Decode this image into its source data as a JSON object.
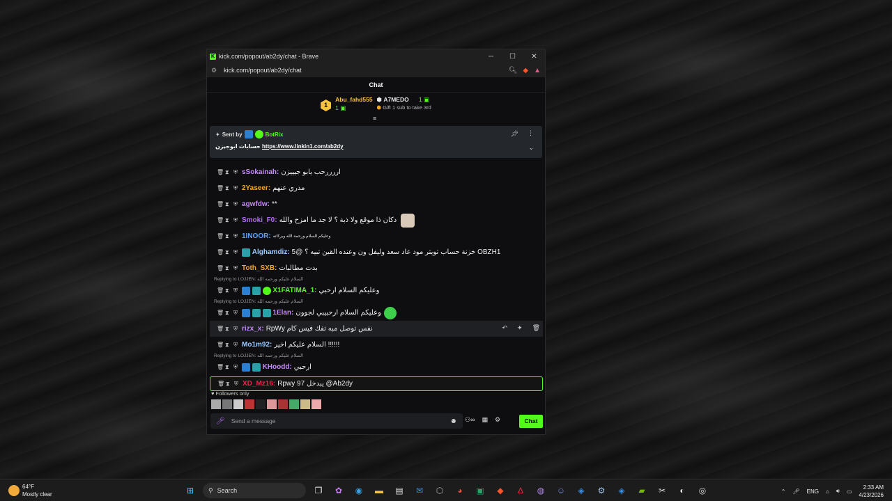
{
  "window": {
    "title": "kick.com/popout/ab2dy/chat - Brave",
    "url": "kick.com/popout/ab2dy/chat",
    "minimize": "─",
    "maximize": "☐",
    "close": "✕"
  },
  "chat": {
    "header": "Chat",
    "top_gifters": {
      "rank": "1",
      "first_name": "Abu_fahd555",
      "first_count": "1",
      "second_name": "A7MEDO",
      "second_count": "1",
      "note": "Gift 1 sub to take 3rd"
    },
    "pinned": {
      "sent_by_label": "Sent by",
      "sent_by_user": "BotRix",
      "message_prefix": "حسابات ابوجيزن",
      "message_link": "https://www.linkin1.com/ab2dy"
    },
    "messages": [
      {
        "user": "sSokainah:",
        "color": "#c58af9",
        "text": "اررررحب يابو جيييزن"
      },
      {
        "user": "2Yaseer:",
        "color": "#f5a623",
        "text": "مدري عنهم"
      },
      {
        "user": "agwfdw:",
        "color": "#c58af9",
        "text": "**"
      },
      {
        "user": "Smoki_F0:",
        "color": "#b36cf5",
        "text": "دكان ذا موقع ولا ذبة ؟ لا جد ما امزح والله"
      },
      {
        "user": "1INOOR:",
        "color": "#5aa0ff",
        "text": "وعليكم السلام ورحمة الله وبركاته"
      },
      {
        "user": "Alghamdiz:",
        "color": "#9ecbff",
        "text": "5@ خزنة حساب تويتر مود عاد سعد وليفل ون وعنده القين تبيه ؟ OBZH1"
      },
      {
        "user": "Toth_SXB:",
        "color": "#f5a623",
        "text": "بدت مطالبات"
      },
      {
        "reply": "Replying to LOJJEN: السلام عليكم ورحمه الله",
        "user": "X1FATIMA_1:",
        "color": "#53fc18",
        "text": "وعليكم السلام ارحبي"
      },
      {
        "reply": "Replying to LOJJEN: السلام عليكم ورحمه الله",
        "user": "1Elan:",
        "color": "#c58af9",
        "text": "وعليكم السلام ارحبيبي لجوون"
      },
      {
        "user": "rizx_x:",
        "color": "#c58af9",
        "text": "RpWy نفس توصل مبه تفك فيس كام"
      },
      {
        "user": "Mo1m92:",
        "color": "#9ecbff",
        "text": "السلام عليكم اخير !!!!!!"
      },
      {
        "reply": "Replying to LOJJEN: السلام عليكم ورحمه الله",
        "user": "KHoodd:",
        "color": "#c58af9",
        "text": "ارحبي"
      },
      {
        "user": "XD_Mz16:",
        "color": "#e8264a",
        "text": "Rpwy 97 يبدخل @Ab2dy"
      }
    ],
    "followers_only": "Followers only",
    "composer_placeholder": "Send a message",
    "send_label": "Chat"
  },
  "taskbar": {
    "weather_temp": "64°F",
    "weather_desc": "Mostly clear",
    "search_label": "Search",
    "lang": "ENG",
    "time": "2:33 AM",
    "date": "4/23/2026"
  },
  "colors": {
    "accent": "#53fc18",
    "gift_rank": "#f6c343"
  }
}
